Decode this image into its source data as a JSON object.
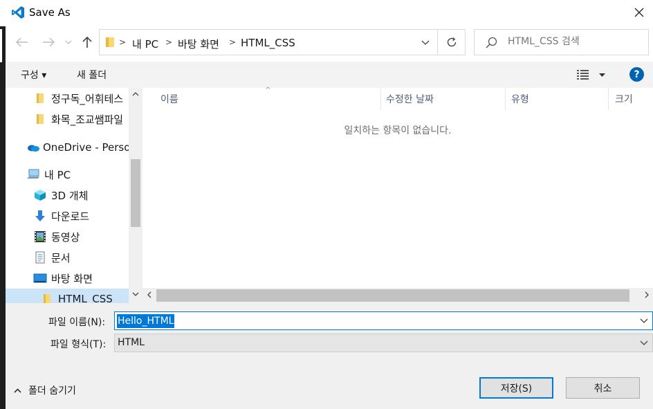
{
  "window": {
    "title": "Save As",
    "close_label": "✕"
  },
  "address": {
    "breadcrumbs": [
      "내 PC",
      "바탕 화면",
      "HTML_CSS"
    ]
  },
  "search": {
    "placeholder": "HTML_CSS 검색"
  },
  "commands": {
    "organize": "구성 ▾",
    "new_folder": "새 폴더"
  },
  "nav_pane": {
    "items": [
      {
        "label": "정구독_어휘테스",
        "icon": "folder-icon"
      },
      {
        "label": "화목_조교쌤파일",
        "icon": "folder-icon"
      },
      {
        "label": "OneDrive - Persor",
        "icon": "onedrive-icon"
      },
      {
        "label": "내 PC",
        "icon": "pc-icon"
      },
      {
        "label": "3D 개체",
        "icon": "3d-objects-icon"
      },
      {
        "label": "다운로드",
        "icon": "download-icon"
      },
      {
        "label": "동영상",
        "icon": "video-icon"
      },
      {
        "label": "문서",
        "icon": "document-icon"
      },
      {
        "label": "바탕 화면",
        "icon": "desktop-icon"
      },
      {
        "label": "HTML_CSS",
        "icon": "folder-icon"
      }
    ]
  },
  "file_list": {
    "columns": [
      "이름",
      "수정한 날짜",
      "유형",
      "크기"
    ],
    "empty_message": "일치하는 항목이 없습니다."
  },
  "form": {
    "filename_label": "파일 이름(N):",
    "filename_value": "Hello_HTML",
    "filetype_label": "파일 형식(T):",
    "filetype_value": "HTML"
  },
  "footer": {
    "hide_folders": "폴더 숨기기",
    "save": "저장(S)",
    "cancel": "취소"
  },
  "colors": {
    "accent": "#0078d7",
    "selection": "#cce4f7",
    "help": "#0063b1"
  }
}
